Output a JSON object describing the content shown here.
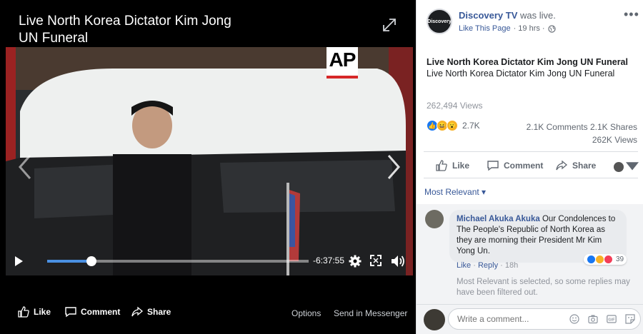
{
  "player": {
    "title": "Live North Korea Dictator Kim Jong UN Funeral",
    "watermark": "AP",
    "progress": 0.17,
    "time_remaining": "-6:37:55",
    "actions": {
      "like": "Like",
      "comment": "Comment",
      "share": "Share",
      "options": "Options",
      "send_in_messenger": "Send in Messenger"
    }
  },
  "post": {
    "page_avatar_text": "Discovery",
    "page_name": "Discovery TV",
    "status": " was live.",
    "like_this_page": "Like This Page",
    "time_ago": "· 19 hrs ·",
    "more": "•••",
    "title": "Live North Korea Dictator Kim Jong UN Funeral",
    "description": "Live North Korea Dictator Kim Jong UN Funeral",
    "views_line": "262,494 Views",
    "reaction_count": "2.7K",
    "comments_shares": "2.1K Comments  2.1K Shares",
    "views_count": "262K Views",
    "actions": {
      "like": "Like",
      "comment": "Comment",
      "share": "Share"
    }
  },
  "comments": {
    "sort_label": "Most Relevant ▾",
    "items": [
      {
        "author": "Michael Akuka Akuka",
        "text": " Our Condolences to The People's Republic of North Korea as they are morning their President Mr Kim Yong Un.",
        "react_count": "39",
        "like": "Like",
        "separator": " · ",
        "reply": "Reply",
        "time": " · 18h"
      }
    ],
    "filter_note": "Most Relevant is selected, so some replies may have been filtered out.",
    "composer_placeholder": "Write a comment..."
  },
  "colors": {
    "link": "#385898",
    "progress": "#4a90e2",
    "player_bg": "#000000"
  }
}
